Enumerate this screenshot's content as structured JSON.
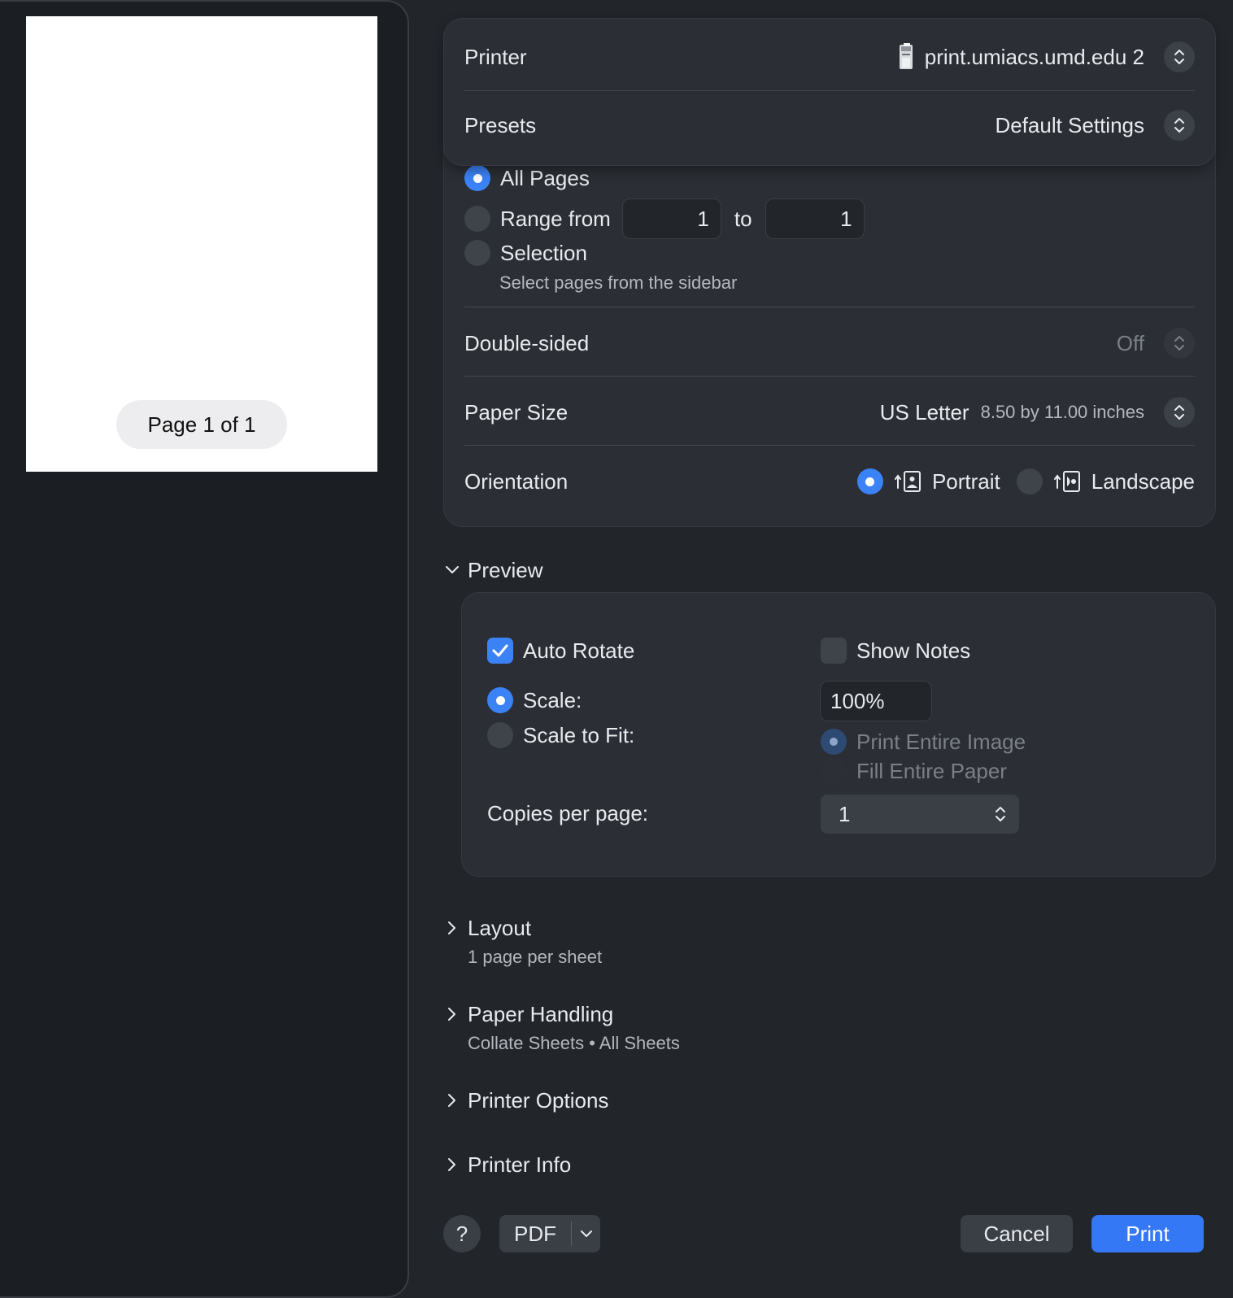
{
  "sidebar": {
    "page_indicator": "Page 1 of 1"
  },
  "printer": {
    "label": "Printer",
    "value": "print.umiacs.umd.edu 2",
    "icon": "printer-icon"
  },
  "presets": {
    "label": "Presets",
    "value": "Default Settings"
  },
  "pages": {
    "all_pages_label": "All Pages",
    "range_label": "Range from",
    "range_from": "1",
    "range_to_label": "to",
    "range_to": "1",
    "selection_label": "Selection",
    "selection_hint": "Select pages from the sidebar",
    "selected": "all"
  },
  "double_sided": {
    "label": "Double-sided",
    "value": "Off"
  },
  "paper_size": {
    "label": "Paper Size",
    "value": "US Letter",
    "detail": "8.50 by 11.00 inches"
  },
  "orientation": {
    "label": "Orientation",
    "portrait_label": "Portrait",
    "landscape_label": "Landscape",
    "selected": "portrait"
  },
  "preview": {
    "title": "Preview",
    "expanded": true,
    "auto_rotate_label": "Auto Rotate",
    "auto_rotate_checked": true,
    "show_notes_label": "Show Notes",
    "show_notes_checked": false,
    "scale_label": "Scale:",
    "scale_value": "100%",
    "scale_to_fit_label": "Scale to Fit:",
    "print_entire_image_label": "Print Entire Image",
    "fill_entire_paper_label": "Fill Entire Paper",
    "copies_per_page_label": "Copies per page:",
    "copies_per_page_value": "1"
  },
  "sections": {
    "layout_title": "Layout",
    "layout_summary": "1 page per sheet",
    "paper_handling_title": "Paper Handling",
    "paper_handling_summary": "Collate Sheets • All Sheets",
    "printer_options_title": "Printer Options",
    "printer_info_title": "Printer Info"
  },
  "footer": {
    "help_label": "?",
    "pdf_label": "PDF",
    "cancel_label": "Cancel",
    "print_label": "Print"
  },
  "colors": {
    "accent": "#3b82f6",
    "print_button": "#3478f6",
    "background": "#22262b",
    "sidebar": "#1b1e22"
  }
}
